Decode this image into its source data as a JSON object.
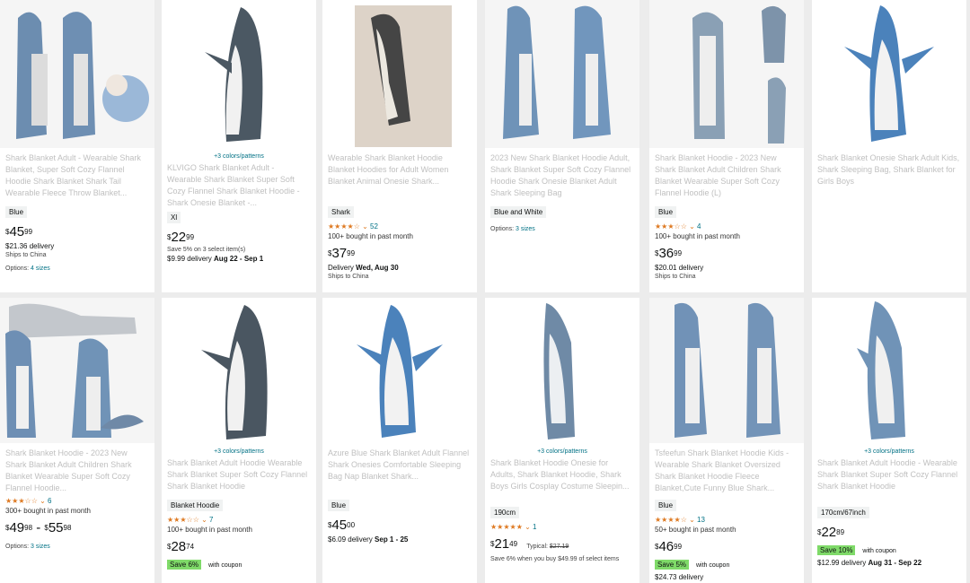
{
  "products": [
    {
      "title": "Shark Blanket Adult - Wearable Shark Blanket, Super Soft Cozy Flannel Hoodie Shark Blanket Shark Tail Wearable Fleece Throw Blanket...",
      "variant": "Blue",
      "price_whole": "45",
      "price_fraction": "99",
      "delivery": "$21.36 delivery",
      "ships": "Ships to China",
      "options": "Options: ",
      "options_link": "4 sizes"
    },
    {
      "colors": "+3 colors/patterns",
      "title": "KLVIGO Shark Blanket Adult - Wearable Shark Blanket Super Soft Cozy Flannel Shark Blanket Hoodie - Shark Onesie Blanket -...",
      "variant": "Xl",
      "price_whole": "22",
      "price_fraction": "99",
      "save_note": "Save 5% on 3 select item(s)",
      "delivery": "$9.99 delivery ",
      "delivery_dates": "Aug 22 - Sep 1"
    },
    {
      "title": "Wearable Shark Blanket Hoodie Blanket Hoodies for Adult Women Blanket Animal Onesie Shark...",
      "variant": "Shark",
      "rating": "52",
      "bought": "100+ bought in past month",
      "price_whole": "37",
      "price_fraction": "99",
      "delivery": "Delivery ",
      "delivery_dates": "Wed, Aug 30",
      "ships": "Ships to China"
    },
    {
      "title": "2023 New Shark Blanket Hoodie Adult, Shark Blanket Super Soft Cozy Flannel Hoodie Shark Onesie Blanket Adult Shark Sleeping Bag",
      "variant": "Blue and White",
      "options": "Options: ",
      "options_link": "3 sizes"
    },
    {
      "title": "Shark Blanket Hoodie - 2023 New Shark Blanket Adult Children Shark Blanket Wearable Super Soft Cozy Flannel Hoodie (L)",
      "variant": "Blue",
      "rating": "4",
      "bought": "100+ bought in past month",
      "price_whole": "36",
      "price_fraction": "99",
      "delivery": "$20.01 delivery",
      "ships": "Ships to China"
    },
    {
      "title": "Shark Blanket Onesie Shark Adult Kids, Shark Sleeping Bag, Shark Blanket for Girls Boys"
    },
    {
      "title": "Shark Blanket Hoodie - 2023 New Shark Blanket Adult Children Shark Blanket Wearable Super Soft Cozy Flannel Hoodie...",
      "rating": "6",
      "bought": "300+ bought in past month",
      "price_whole": "49",
      "price_fraction": "98",
      "price2_whole": "55",
      "price2_fraction": "98",
      "options": "Options: ",
      "options_link": "3 sizes"
    },
    {
      "colors": "+3 colors/patterns",
      "title": "Shark Blanket Adult Hoodie Wearable Shark Blanket Super Soft Cozy Flannel Shark Blanket Hoodie",
      "variant": "Blanket Hoodie",
      "rating": "7",
      "bought": "100+ bought in past month",
      "price_whole": "28",
      "price_fraction": "74",
      "save": "Save 6%",
      "coupon": " with coupon"
    },
    {
      "title": "Azure Blue Shark Blanket Adult Flannel Shark Onesies Comfortable Sleeping Bag Nap Blanket Shark...",
      "variant": "Blue",
      "price_whole": "45",
      "price_fraction": "00",
      "delivery": "$6.09 delivery ",
      "delivery_dates": "Sep 1 - 25"
    },
    {
      "colors": "+3 colors/patterns",
      "title": "Shark Blanket Hoodie Onesie for Adults, Shark Blanket Hoodie, Shark Boys Girls Cosplay Costume Sleepin...",
      "variant": "190cm",
      "rating": "1",
      "price_whole": "21",
      "price_fraction": "49",
      "typical": "Typical: ",
      "typical_price": "$27.19",
      "save_note": "Save 6% when you buy $49.99 of select items"
    },
    {
      "title": "Tsfeefun Shark Blanket Hoodie Kids - Wearable Shark Blanket Oversized Shark Blanket Hoodie Fleece Blanket,Cute Funny Blue Shark...",
      "variant": "Blue",
      "rating": "13",
      "bought": "50+ bought in past month",
      "price_whole": "46",
      "price_fraction": "99",
      "save": "Save 5%",
      "coupon": " with coupon",
      "delivery": "$24.73 delivery"
    },
    {
      "colors": "+3 colors/patterns",
      "title": "Shark Blanket Adult Hoodie - Wearable Shark Blanket Super Soft Cozy Flannel Shark Blanket Hoodie",
      "variant": "170cm/67inch",
      "price_whole": "22",
      "price_fraction": "89",
      "save": "Save 10%",
      "coupon": " with coupon",
      "delivery": "$12.99 delivery ",
      "delivery_dates": "Aug 31 - Sep 22"
    }
  ],
  "icons": {
    "shark": "shark-wearable-blanket-photo",
    "star": "star-rating-icon"
  },
  "colors": {
    "link": "#007185",
    "save_badge": "#7fda69",
    "star": "#de7921"
  }
}
